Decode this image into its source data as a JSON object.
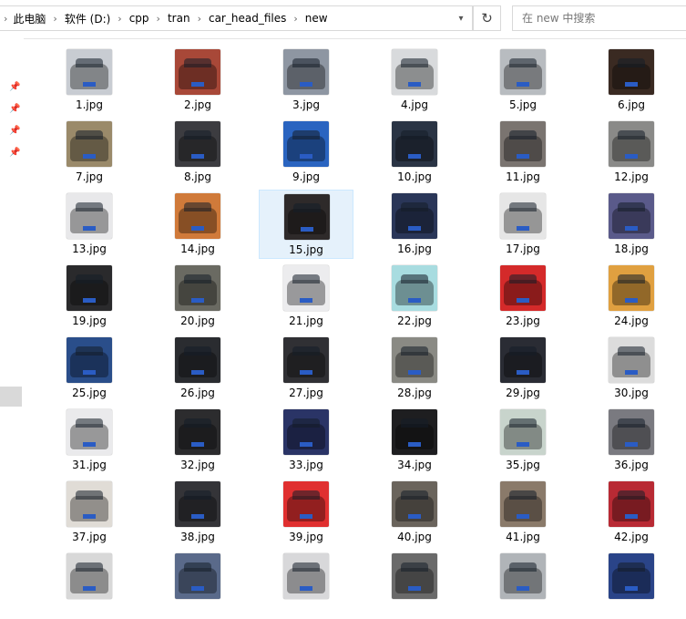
{
  "address": {
    "segments": [
      "此电脑",
      "软件 (D:)",
      "cpp",
      "tran",
      "car_head_files",
      "new"
    ]
  },
  "search": {
    "placeholder": "在 new 中搜索"
  },
  "files": [
    {
      "name": "1.jpg",
      "color": "#c8ccd2"
    },
    {
      "name": "2.jpg",
      "color": "#a84838"
    },
    {
      "name": "3.jpg",
      "color": "#8e96a2"
    },
    {
      "name": "4.jpg",
      "color": "#d8dadc"
    },
    {
      "name": "5.jpg",
      "color": "#b8bcc0"
    },
    {
      "name": "6.jpg",
      "color": "#3a2a22"
    },
    {
      "name": "7.jpg",
      "color": "#9a8a6a"
    },
    {
      "name": "8.jpg",
      "color": "#3c3c40"
    },
    {
      "name": "9.jpg",
      "color": "#2a64c0"
    },
    {
      "name": "10.jpg",
      "color": "#2a3444"
    },
    {
      "name": "11.jpg",
      "color": "#7a7470"
    },
    {
      "name": "12.jpg",
      "color": "#8a8a88"
    },
    {
      "name": "13.jpg",
      "color": "#e8e8ea"
    },
    {
      "name": "14.jpg",
      "color": "#d07a3a"
    },
    {
      "name": "15.jpg",
      "color": "#2e2a2a"
    },
    {
      "name": "16.jpg",
      "color": "#2a3658"
    },
    {
      "name": "17.jpg",
      "color": "#e6e6e6"
    },
    {
      "name": "18.jpg",
      "color": "#5a5a8a"
    },
    {
      "name": "19.jpg",
      "color": "#2a2a2c"
    },
    {
      "name": "20.jpg",
      "color": "#6a6a62"
    },
    {
      "name": "21.jpg",
      "color": "#ececee"
    },
    {
      "name": "22.jpg",
      "color": "#a8dce0"
    },
    {
      "name": "23.jpg",
      "color": "#d42a2a"
    },
    {
      "name": "24.jpg",
      "color": "#e0a040"
    },
    {
      "name": "25.jpg",
      "color": "#2a4e8a"
    },
    {
      "name": "26.jpg",
      "color": "#2a2c30"
    },
    {
      "name": "27.jpg",
      "color": "#303034"
    },
    {
      "name": "28.jpg",
      "color": "#8a8a84"
    },
    {
      "name": "29.jpg",
      "color": "#2a2c34"
    },
    {
      "name": "30.jpg",
      "color": "#dcdcdc"
    },
    {
      "name": "31.jpg",
      "color": "#eaeaec"
    },
    {
      "name": "32.jpg",
      "color": "#2c2c2e"
    },
    {
      "name": "33.jpg",
      "color": "#2a3466"
    },
    {
      "name": "34.jpg",
      "color": "#1e1e20"
    },
    {
      "name": "35.jpg",
      "color": "#c8d4cc"
    },
    {
      "name": "36.jpg",
      "color": "#7a7a80"
    },
    {
      "name": "37.jpg",
      "color": "#e0dcd6"
    },
    {
      "name": "38.jpg",
      "color": "#343438"
    },
    {
      "name": "39.jpg",
      "color": "#e03030"
    },
    {
      "name": "40.jpg",
      "color": "#6a645c"
    },
    {
      "name": "41.jpg",
      "color": "#8a7a6a"
    },
    {
      "name": "42.jpg",
      "color": "#b82a34"
    },
    {
      "name": "",
      "color": "#d8d8d8"
    },
    {
      "name": "",
      "color": "#5a6a8a"
    },
    {
      "name": "",
      "color": "#d8d8da"
    },
    {
      "name": "",
      "color": "#6a6a6a"
    },
    {
      "name": "",
      "color": "#b0b4b8"
    },
    {
      "name": "",
      "color": "#2a4488"
    }
  ],
  "selected_file": "15.jpg",
  "icons": {
    "separator": "chevron-right-icon",
    "refresh": "refresh-icon",
    "search": "search-icon",
    "pin": "pin-icon"
  }
}
